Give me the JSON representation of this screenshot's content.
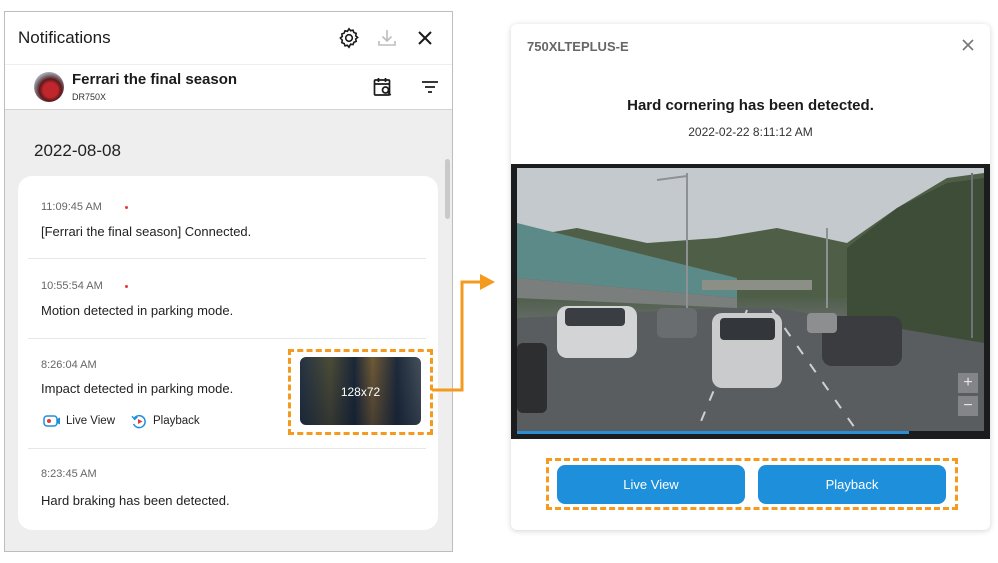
{
  "notifications_panel": {
    "title": "Notifications",
    "header_icons": [
      "gear-icon",
      "download-icon",
      "close-icon"
    ],
    "device": {
      "name": "Ferrari the final season",
      "model": "DR750X"
    },
    "date": "2022-08-08",
    "items": [
      {
        "time": "11:09:45 AM",
        "unread": true,
        "message": "[Ferrari the final season] Connected."
      },
      {
        "time": "10:55:54 AM",
        "unread": true,
        "message": "Motion detected in parking mode."
      },
      {
        "time": "8:26:04 AM",
        "unread": false,
        "message": "Impact detected in parking mode.",
        "actions": {
          "live_view": "Live View",
          "playback": "Playback"
        },
        "thumbnail_label": "128x72"
      },
      {
        "time": "8:23:45 AM",
        "unread": false,
        "message": "Hard braking has been detected."
      }
    ]
  },
  "popup": {
    "device": "750XLTEPLUS-E",
    "headline": "Hard cornering has been detected.",
    "datetime": "2022-02-22  8:11:12 AM",
    "video": {
      "zoom_in": "+",
      "zoom_out": "−"
    },
    "buttons": {
      "live_view": "Live View",
      "playback": "Playback"
    }
  },
  "colors": {
    "accent": "#1e8fdb",
    "highlight": "#f39a1f",
    "unread_dot": "#e53935"
  }
}
